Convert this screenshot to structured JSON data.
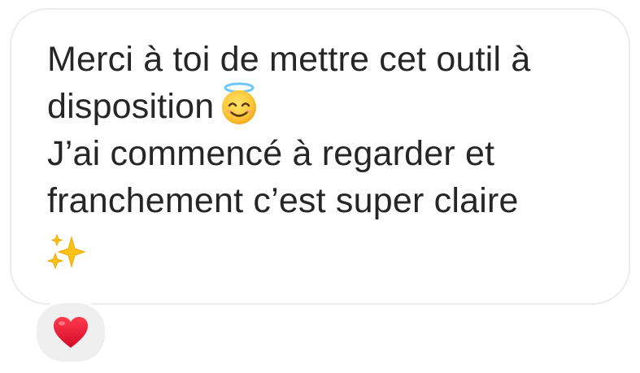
{
  "message": {
    "line1": "Merci à toi de mettre cet outil à",
    "line2": "disposition",
    "line3": "J’ai commencé à regarder et",
    "line4": "franchement c’est super claire"
  },
  "icons": {
    "face_emoji": "smiling-face-with-halo-icon",
    "sparkles_emoji": "sparkles-icon",
    "reaction": "red-heart-icon"
  },
  "colors": {
    "text": "#262626",
    "bubble_border": "#ececec",
    "reaction_bg": "#efefef",
    "heart": "#e8112d"
  }
}
